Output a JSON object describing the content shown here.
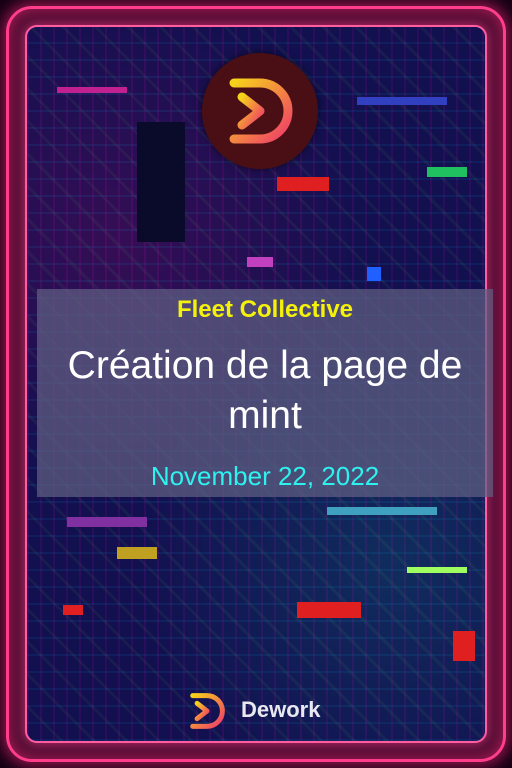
{
  "card": {
    "organization": "Fleet Collective",
    "title": "Création de la page de mint",
    "date": "November 22, 2022"
  },
  "brand": {
    "name": "Dework",
    "logo_icon": "dework-logo-icon"
  },
  "colors": {
    "frame": "#ff3d8a",
    "organization_text": "#f5f20a",
    "title_text": "#ffffff",
    "date_text": "#2ef2ee",
    "banner": "#5f5f82",
    "background": "#12104f"
  }
}
